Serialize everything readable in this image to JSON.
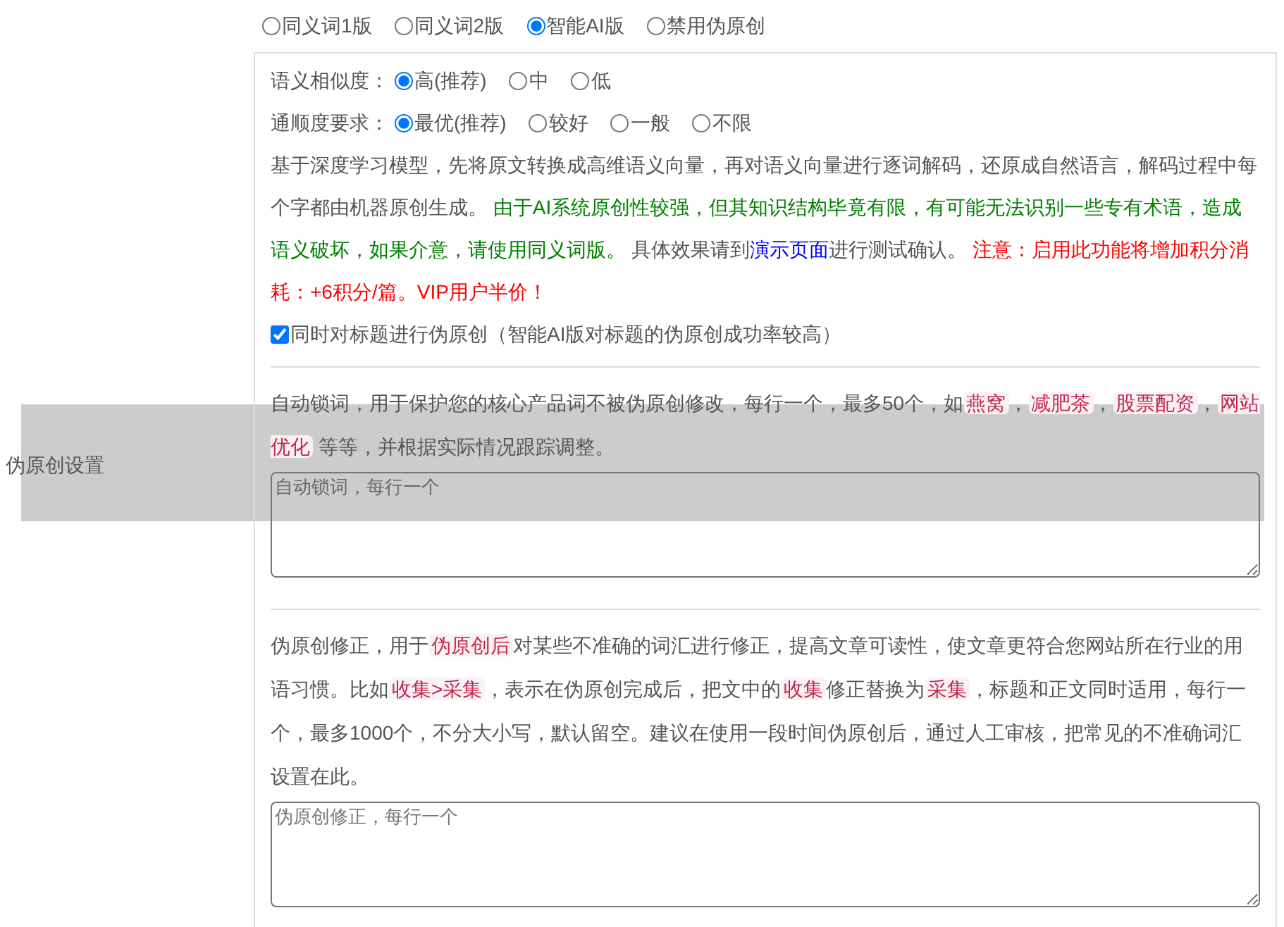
{
  "version_options": [
    {
      "label": "同义词1版",
      "selected": false
    },
    {
      "label": "同义词2版",
      "selected": false
    },
    {
      "label": "智能AI版",
      "selected": true
    },
    {
      "label": "禁用伪原创",
      "selected": false
    }
  ],
  "settings_label": "伪原创设置",
  "similarity": {
    "label": "语义相似度：",
    "options": [
      {
        "label": "高(推荐)",
        "selected": true
      },
      {
        "label": "中",
        "selected": false
      },
      {
        "label": "低",
        "selected": false
      }
    ]
  },
  "fluency": {
    "label": "通顺度要求：",
    "options": [
      {
        "label": "最优(推荐)",
        "selected": true
      },
      {
        "label": "较好",
        "selected": false
      },
      {
        "label": "一般",
        "selected": false
      },
      {
        "label": "不限",
        "selected": false
      }
    ]
  },
  "ai_description": [
    {
      "kind": "plain",
      "text": "基于深度学习模型，先将原文转换成高维语义向量，再对语义向量进行逐词解码，还原成自然语言，解码过程中每个字都由机器原创生成。 "
    },
    {
      "kind": "success",
      "text": "由于AI系统原创性较强，但其知识结构毕竟有限，有可能无法识别一些专有术语，造成语义破坏，如果介意，请使用同义词版。"
    },
    {
      "kind": "plain",
      "text": " 具体效果请到"
    },
    {
      "kind": "link",
      "text": "演示页面"
    },
    {
      "kind": "plain",
      "text": "进行测试确认。 "
    },
    {
      "kind": "warning",
      "text": "注意：启用此功能将增加积分消耗：+6积分/篇。VIP用户半价！"
    }
  ],
  "title_option": {
    "label": "同时对标题进行伪原创（智能AI版对标题的伪原创成功率较高）",
    "checked": true
  },
  "lock_words": {
    "description": [
      {
        "kind": "plain",
        "text": "自动锁词，用于保护您的核心产品词不被伪原创修改，每行一个，最多50个，如"
      },
      {
        "kind": "tag",
        "text": "燕窝"
      },
      {
        "kind": "plain",
        "text": "，"
      },
      {
        "kind": "tag",
        "text": "减肥茶"
      },
      {
        "kind": "plain",
        "text": "，"
      },
      {
        "kind": "tag",
        "text": "股票配资"
      },
      {
        "kind": "plain",
        "text": "，"
      },
      {
        "kind": "tag",
        "text": "网站优化"
      },
      {
        "kind": "plain",
        "text": " 等等，并根据实际情况跟踪调整。"
      }
    ],
    "placeholder": "自动锁词，每行一个"
  },
  "correction": {
    "description": [
      {
        "kind": "plain",
        "text": "伪原创修正，用于"
      },
      {
        "kind": "tag",
        "text": "伪原创后"
      },
      {
        "kind": "plain",
        "text": "对某些不准确的词汇进行修正，提高文章可读性，使文章更符合您网站所在行业的用语习惯。比如"
      },
      {
        "kind": "tag",
        "text": "收集>采集"
      },
      {
        "kind": "plain",
        "text": "，表示在伪原创完成后，把文中的"
      },
      {
        "kind": "tag",
        "text": "收集"
      },
      {
        "kind": "plain",
        "text": "修正替换为"
      },
      {
        "kind": "tag",
        "text": "采集"
      },
      {
        "kind": "plain",
        "text": "，标题和正文同时适用，每行一个，最多1000个，不分大小写，默认留空。建议在使用一段时间伪原创后，通过人工审核，把常见的不准确词汇设置在此。"
      }
    ],
    "placeholder": "伪原创修正，每行一个"
  }
}
